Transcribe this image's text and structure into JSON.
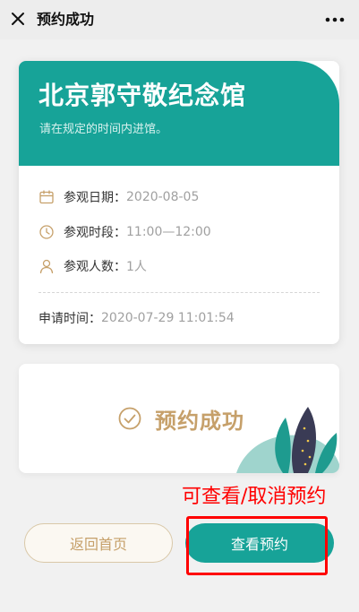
{
  "topbar": {
    "title": "预约成功"
  },
  "ticket": {
    "museum_name": "北京郭守敬纪念馆",
    "subtitle": "请在规定的时间内进馆。",
    "date_label": "参观日期：",
    "date_value": "2020-08-05",
    "time_label": "参观时段：",
    "time_value": "11:00—12:00",
    "people_label": "参观人数：",
    "people_value": "1人",
    "apply_label": "申请时间：",
    "apply_value": "2020-07-29 11:01:54"
  },
  "success": {
    "text": "预约成功"
  },
  "annotation": {
    "text": "可查看/取消预约"
  },
  "buttons": {
    "home": "返回首页",
    "view": "查看预约"
  },
  "colors": {
    "primary": "#17a398",
    "gold": "#c6a06a",
    "annotation_red": "#ff0000"
  },
  "icons": {
    "close": "close-icon",
    "more": "more-icon",
    "date": "calendar-icon",
    "time": "clock-icon",
    "people": "person-icon",
    "success": "check-circle-icon"
  }
}
